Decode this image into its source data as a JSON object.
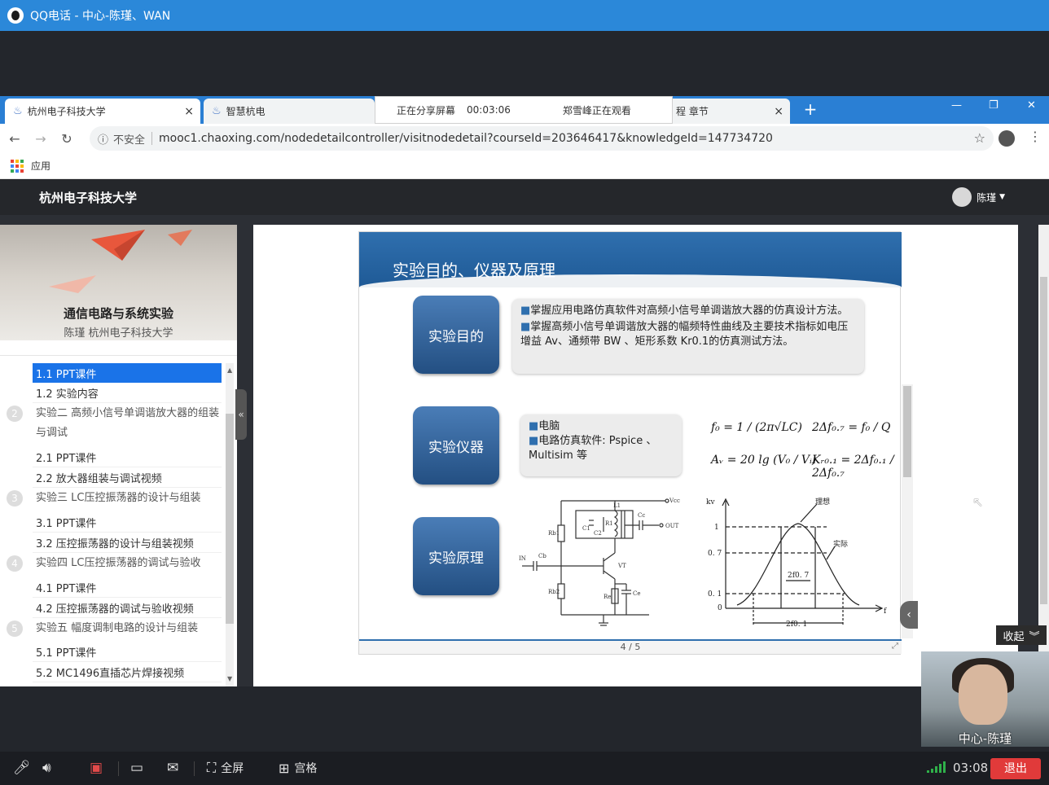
{
  "qq_window": {
    "title": "QQ电话 - 中心-陈瑾、WAN"
  },
  "browser": {
    "tabs": [
      {
        "label": "杭州电子科技大学",
        "close": "×"
      },
      {
        "label": "智慧杭电"
      },
      {
        "label": "程 章节",
        "close": "×"
      }
    ],
    "share_bar": {
      "status": "正在分享屏幕",
      "elapsed": "00:03:06",
      "viewer": "郑雪峰正在观看"
    },
    "new_tab": "+",
    "window_controls": [
      "—",
      "❐",
      "✕"
    ],
    "security_label": "不安全",
    "url": "mooc1.chaoxing.com/nodedetailcontroller/visitnodedetail?courseId=203646417&knowledgeId=147734720",
    "bookmarks_label": "应用"
  },
  "site": {
    "name": "杭州电子科技大学",
    "user": "陈瑾",
    "course_title": "通信电路与系统实验",
    "course_subtitle": "陈瑾 杭州电子科技大学"
  },
  "sidebar": {
    "items": [
      {
        "type": "item",
        "label": "1.1  PPT课件",
        "active": true
      },
      {
        "type": "item",
        "label": "1.2  实验内容"
      },
      {
        "type": "chapter",
        "num": "2",
        "label": "实验二 高频小信号单调谐放大器的组装与调试"
      },
      {
        "type": "item",
        "label": "2.1  PPT课件"
      },
      {
        "type": "item",
        "label": "2.2  放大器组装与调试视频"
      },
      {
        "type": "chapter",
        "num": "3",
        "label": "实验三 LC压控振荡器的设计与组装"
      },
      {
        "type": "item",
        "label": "3.1  PPT课件"
      },
      {
        "type": "item",
        "label": "3.2  压控振荡器的设计与组装视频"
      },
      {
        "type": "chapter",
        "num": "4",
        "label": "实验四  LC压控振荡器的调试与验收"
      },
      {
        "type": "item",
        "label": "4.1  PPT课件"
      },
      {
        "type": "item",
        "label": "4.2  压控振荡器的调试与验收视频"
      },
      {
        "type": "chapter",
        "num": "5",
        "label": "实验五  幅度调制电路的设计与组装"
      },
      {
        "type": "item",
        "label": "5.1  PPT课件"
      },
      {
        "type": "item",
        "label": "5.2  MC1496直插芯片焊接视频"
      }
    ]
  },
  "slide": {
    "title": "实验目的、仪器及原理",
    "buttons": {
      "purpose": "实验目的",
      "instruments": "实验仪器",
      "principle": "实验原理"
    },
    "purpose_lines": [
      "掌握应用电路仿真软件对高频小信号单调谐放大器的仿真设计方法。",
      "掌握高频小信号单调谐放大器的幅频特性曲线及主要技术指标如电压增益 Av、通频带 BW 、矩形系数 Kr0.1的仿真测试方法。"
    ],
    "instrument_lines": [
      "电脑",
      "电路仿真软件:  Pspice 、Multisim 等"
    ],
    "formula_f0": "f₀ = 1 / (2π√LC)",
    "formula_av": "Aᵥ = 20 lg (V₀ / Vᵢ)",
    "formula_bw": "2Δf₀.₇ = f₀ / Q",
    "formula_kr": "Kᵣ₀.₁ = 2Δf₀.₁ / 2Δf₀.₇",
    "circuit_labels": {
      "vcc": "Vcc",
      "out": "OUT",
      "in": "IN",
      "vt": "VT",
      "cb": "Cb",
      "rb1": "Rb1",
      "rb2": "Rb2",
      "re": "Re",
      "ce": "Ce",
      "c1": "C1",
      "c2": "C2",
      "r1": "R1",
      "l1": "L1",
      "cc": "Cc"
    },
    "response_chart": {
      "ylabel": "kv",
      "xlabel": "f",
      "ticks": [
        "1",
        "0. 7",
        "0. 1",
        "0"
      ],
      "ideal": "理想",
      "actual": "实际",
      "bw07": "2f0. 7",
      "bw01": "2f0. 1"
    },
    "page": "4 / 5"
  },
  "call": {
    "collapse_label": "收起",
    "video_label": "中心-陈瑾",
    "fullscreen": "全屏",
    "grid": "宫格",
    "timer": "03:08",
    "exit": "退出"
  }
}
